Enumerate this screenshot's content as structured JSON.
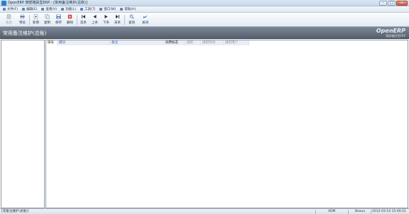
{
  "window": {
    "title": "OpenERP 微部箱民型ERP - [常用备注维护(总账)]",
    "minimize": "–",
    "maximize": "□",
    "close": "✕"
  },
  "menu": [
    {
      "label": "文件(F)"
    },
    {
      "label": "编辑(E)"
    },
    {
      "label": "查看(V)"
    },
    {
      "label": "功能(L)"
    },
    {
      "label": "工具(T)"
    },
    {
      "label": "窗口(W)"
    },
    {
      "label": "帮助(H)"
    }
  ],
  "toolbar": [
    {
      "label": "再武",
      "icon": "print-preview-icon",
      "disabled": true
    },
    {
      "label": "预览",
      "icon": "preview-icon",
      "disabled": false
    },
    {
      "label": "新增",
      "icon": "new-icon",
      "disabled": false
    },
    {
      "label": "复制",
      "icon": "copy-icon",
      "disabled": false
    },
    {
      "label": "保存",
      "icon": "save-icon",
      "disabled": false
    },
    {
      "label": "删除",
      "icon": "delete-icon",
      "disabled": false
    },
    {
      "label": "首条",
      "icon": "first-record-icon",
      "disabled": false
    },
    {
      "label": "上条",
      "icon": "previous-record-icon",
      "disabled": false
    },
    {
      "label": "下条",
      "icon": "next-record-icon",
      "disabled": false
    },
    {
      "label": "末条",
      "icon": "last-record-icon",
      "disabled": false
    },
    {
      "label": "查询",
      "icon": "search-icon",
      "disabled": false
    },
    {
      "label": "关闭",
      "icon": "close-icon",
      "disabled": false
    }
  ],
  "banner": {
    "title": "常用备注维护(总账)",
    "logo": "OpenERP",
    "logo_sub": "微部箱民型ERP"
  },
  "grid": {
    "columns": [
      {
        "label": "排号",
        "style": "req"
      },
      {
        "label": "模块",
        "style": "opt"
      },
      {
        "label": "备注",
        "style": "opt"
      },
      {
        "label": "同用标志",
        "style": "req"
      },
      {
        "label": "组织",
        "style": "dis"
      },
      {
        "label": "组织时间",
        "style": "dis"
      },
      {
        "label": "组织用户",
        "style": "dis"
      }
    ],
    "rows": []
  },
  "status": {
    "left": "[常备注维护(总账)]",
    "user": "ADM",
    "company": "Beauv",
    "datetime": "2012-03-14 15:49:21"
  },
  "colors": {
    "banner": "#6b7583",
    "required_header": "#101010",
    "optional_header": "#3f64a8",
    "disabled_header": "#8a9099"
  }
}
